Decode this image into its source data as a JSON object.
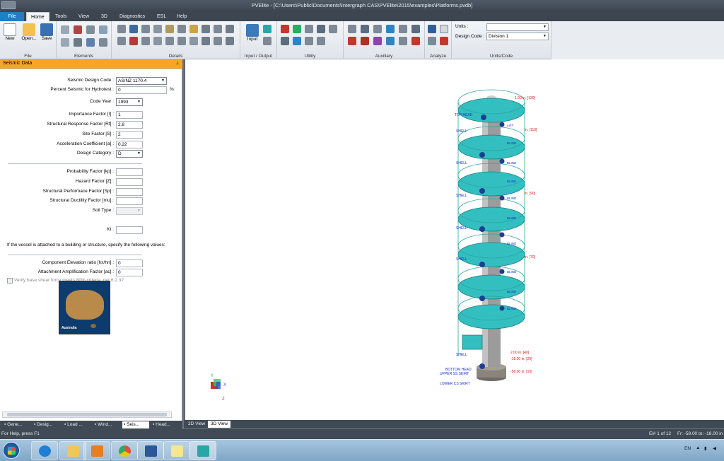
{
  "window": {
    "title": "PVElite - [C:\\Users\\Public\\Documents\\Intergraph CAS\\PVElite\\2015\\examples\\Platforms.pvdb]"
  },
  "ribbon": {
    "tabs": [
      "File",
      "Home",
      "Tools",
      "View",
      "3D",
      "Diagnostics",
      "ESL",
      "Help"
    ],
    "file_group": {
      "name": "File",
      "new_label": "New",
      "open_label": "Open...",
      "save_label": "Save"
    },
    "elements_group": {
      "name": "Elements"
    },
    "details_group": {
      "name": "Details"
    },
    "io_group": {
      "name": "Input / Output",
      "input_label": "Input"
    },
    "utility_group": {
      "name": "Utility"
    },
    "auxiliary_group": {
      "name": "Auxiliary"
    },
    "analyze_group": {
      "name": "Analyze"
    },
    "units_group": {
      "name": "Units/Code",
      "units_label": "Units :",
      "units_value": "",
      "design_code_label": "Design Code :",
      "design_code_value": "Division 1"
    }
  },
  "panel": {
    "title": "Seismic Data",
    "fields": {
      "seismic_code": {
        "label": "Seismic Design Code :",
        "value": "AS/NZ 1170.4"
      },
      "percent_hydro": {
        "label": "Percent Seismic for Hydrotest :",
        "value": "0",
        "unit": "%"
      },
      "code_year": {
        "label": "Code Year :",
        "value": "1993"
      },
      "importance": {
        "label": "Importance Factor [I] :",
        "value": "1"
      },
      "structural_response": {
        "label": "Structural Response Factor [Rf] :",
        "value": "2.8"
      },
      "site_factor": {
        "label": "Site Factor [S] :",
        "value": "2"
      },
      "acceleration": {
        "label": "Acceleration Coefficient [a] :",
        "value": "0.22"
      },
      "design_category": {
        "label": "Design Category :",
        "value": "D"
      },
      "probability": {
        "label": "Probability Factor [kp] :",
        "value": ""
      },
      "hazard": {
        "label": "Hazard Factor [Z] :",
        "value": ""
      },
      "performance": {
        "label": "Structural Performace Factor [Sp] :",
        "value": ""
      },
      "ductility": {
        "label": "Structural Ductility Factor [mu] :",
        "value": ""
      },
      "soil_type": {
        "label": "Soil Type :",
        "value": ""
      },
      "verify_label": "Verify base shear force meets 80% criteria, per 6.2.3?",
      "kt": {
        "label": "Kt :",
        "value": ""
      },
      "attached_note": "If the vessel is attached to a building or structure, specify the following values:",
      "elevation_ratio": {
        "label": "Component Elevation ratio [hx/hn] :",
        "value": "0"
      },
      "amplification": {
        "label": "Attachment Amplification Factor [ac] :",
        "value": "0"
      }
    },
    "map_label": "Australia",
    "bottom_tabs": [
      "Gene...",
      "Desig...",
      "Load ...",
      "Wind...",
      "Seis...",
      "Head..."
    ]
  },
  "viewport": {
    "tabs": [
      "2D View",
      "3D View"
    ],
    "axes": {
      "x": "X",
      "y": "Y",
      "z": "Z"
    },
    "labels_blue": [
      "TOP HEAD",
      "SHELL",
      "SHELL",
      "SHELL",
      "SHELL",
      "SHELL",
      "SHELL",
      "BOTTOM HEAD",
      "UPPER SS SKIRT",
      "LOWER CS SKIRT"
    ],
    "nozzle_labels": [
      "LIFT",
      "BLIND",
      "BLIND",
      "BLIND",
      "BLIND",
      "BLIND",
      "BLIND",
      "BLIND",
      "BLIND",
      "BLIND"
    ],
    "dims_red": [
      "1.00 in.  [130]",
      "in.  [110]",
      "in.  [90]",
      "in.  [70]",
      "2.00 in.  [40]",
      "-18.00 in.  [20]",
      "-58.00 in.  [10]"
    ]
  },
  "status": {
    "help": "For Help, press F1",
    "element": "El# 1 of 12",
    "range": "Fr: -58.00 to: -18.00 in"
  },
  "taskbar": {
    "lang": "EN"
  }
}
